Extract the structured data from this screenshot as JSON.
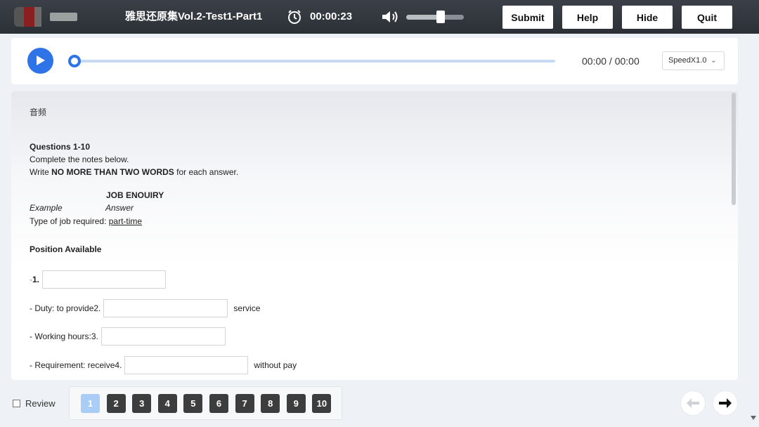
{
  "header": {
    "title": "雅思还原集Vol.2-Test1-Part1",
    "timer": "00:00:23",
    "timer_icon": "alarm-clock-icon",
    "volume_icon": "speaker-icon",
    "volume_level": 0.6,
    "buttons": {
      "submit": "Submit",
      "help": "Help",
      "hide": "Hide",
      "quit": "Quit"
    }
  },
  "player": {
    "play_icon": "play-icon",
    "time": "00:00 / 00:00",
    "progress": 0,
    "speed": "SpeedX1.0"
  },
  "content": {
    "section_label": "音频",
    "questions_heading": "Questions 1-10",
    "instruction1": "Complete the notes below.",
    "instruction2_pre": "Write ",
    "instruction2_bold": "NO MORE THAN TWO WORDS",
    "instruction2_post": " for each answer.",
    "notes_title": "JOB ENOUIRY",
    "example_label": "Example",
    "example_answer_label": "Answer",
    "example_prompt": "Type of job required: ",
    "example_answer": "part-time",
    "position_heading": "Position Available",
    "items": [
      {
        "prefix": "· ",
        "number": "1.",
        "suffix": ""
      },
      {
        "prefix": "- Duty: to provide ",
        "number": "2.",
        "suffix": "service"
      },
      {
        "prefix": "- Working hours: ",
        "number": "3.",
        "suffix": ""
      },
      {
        "prefix": "- Requirement: receive ",
        "number": "4.",
        "suffix": "without pay"
      }
    ]
  },
  "footer": {
    "review_label": "Review",
    "question_numbers": [
      "1",
      "2",
      "3",
      "4",
      "5",
      "6",
      "7",
      "8",
      "9",
      "10"
    ],
    "current_question": "1",
    "prev_icon": "arrow-left-icon",
    "next_icon": "arrow-right-icon"
  },
  "colors": {
    "accent": "#2e73e8",
    "topbar": "#33373d",
    "current_question": "#a9cdf6"
  }
}
